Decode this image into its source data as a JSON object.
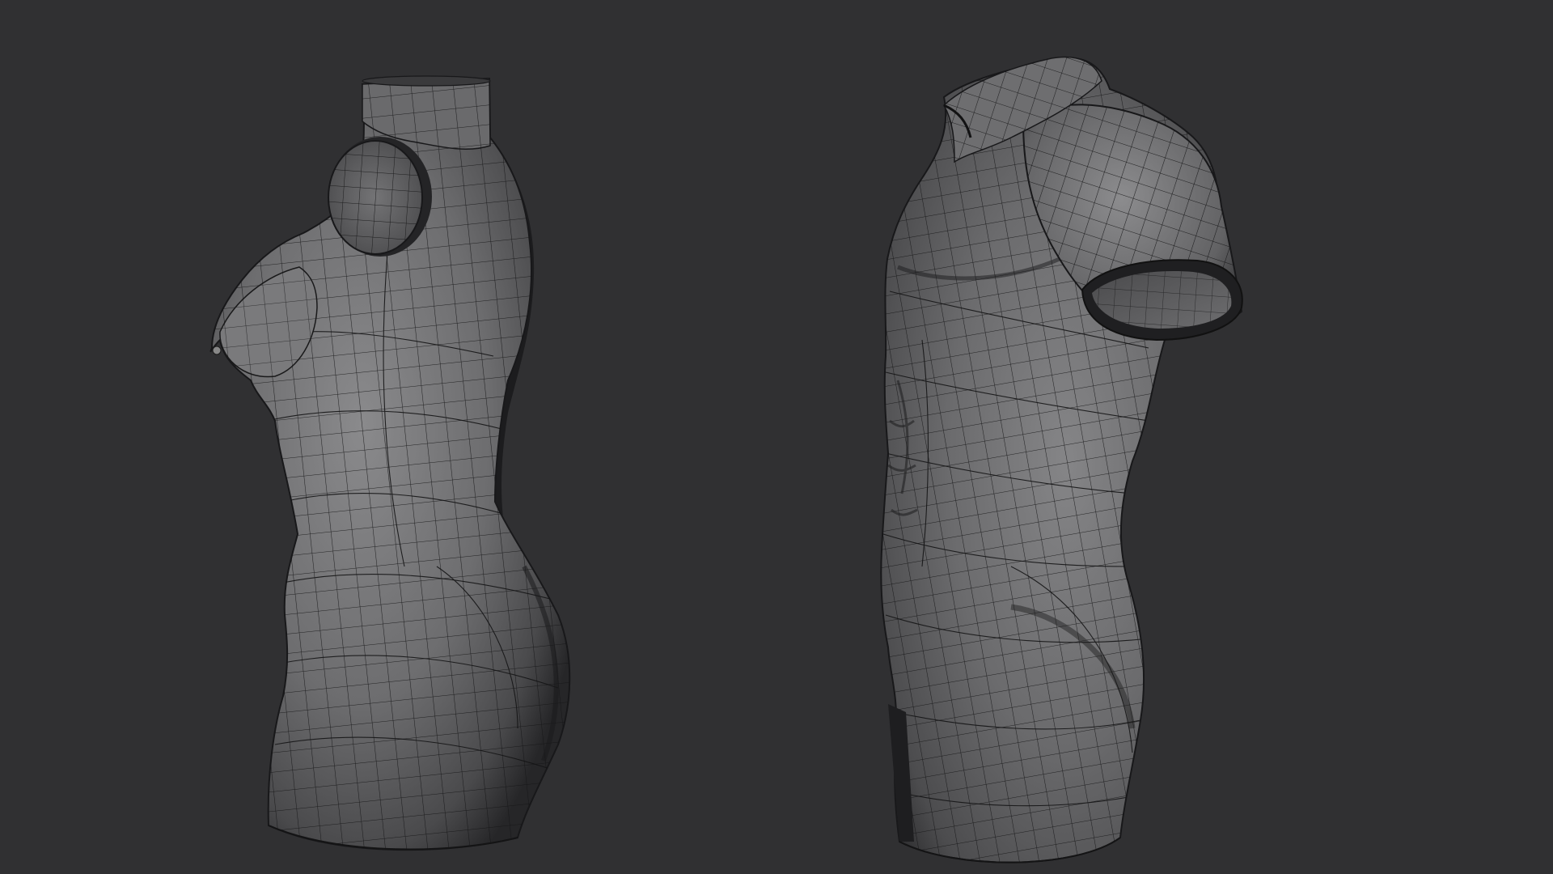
{
  "viewport": {
    "background_color": "#303032"
  },
  "scene": {
    "mesh_base_color": "#6c6c6e",
    "mesh_shadow_color": "#1f1f21",
    "mesh_highlight_color": "#8e8e90",
    "wireframe_color": "#161617",
    "models": [
      {
        "id": "female-torso",
        "view": "side"
      },
      {
        "id": "male-torso",
        "view": "three-quarter"
      }
    ]
  }
}
